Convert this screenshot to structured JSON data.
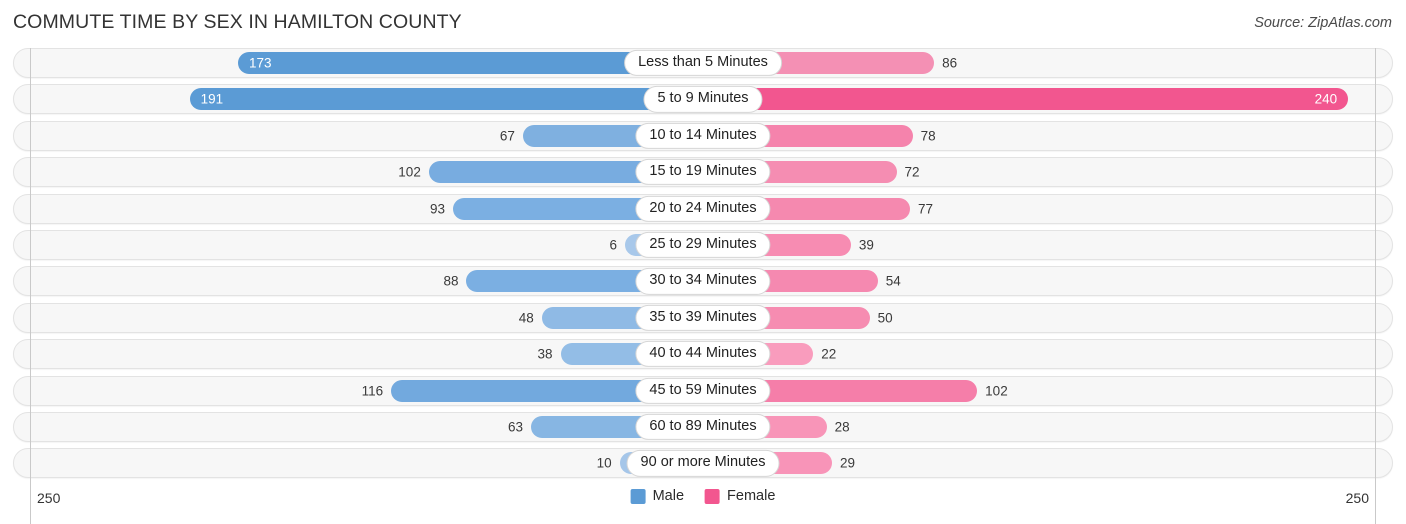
{
  "header": {
    "title": "COMMUTE TIME BY SEX IN HAMILTON COUNTY",
    "source": "Source: ZipAtlas.com"
  },
  "legend": {
    "male_label": "Male",
    "female_label": "Female",
    "male_color": "#5b9bd5",
    "female_color": "#f2568f"
  },
  "axis": {
    "left_max": "250",
    "right_max": "250"
  },
  "chart_data": {
    "type": "bar",
    "orientation": "horizontal-diverging",
    "title": "COMMUTE TIME BY SEX IN HAMILTON COUNTY",
    "xlabel": "",
    "ylabel": "",
    "axis_max": 250,
    "grid": false,
    "legend_position": "bottom-center",
    "categories": [
      "Less than 5 Minutes",
      "5 to 9 Minutes",
      "10 to 14 Minutes",
      "15 to 19 Minutes",
      "20 to 24 Minutes",
      "25 to 29 Minutes",
      "30 to 34 Minutes",
      "35 to 39 Minutes",
      "40 to 44 Minutes",
      "45 to 59 Minutes",
      "60 to 89 Minutes",
      "90 or more Minutes"
    ],
    "series": [
      {
        "name": "Male",
        "color": "#5b9bd5",
        "values": [
          173,
          191,
          67,
          102,
          93,
          6,
          88,
          48,
          38,
          116,
          63,
          10
        ]
      },
      {
        "name": "Female",
        "color": "#f2568f",
        "values": [
          86,
          240,
          78,
          72,
          77,
          39,
          54,
          50,
          22,
          102,
          28,
          29
        ]
      }
    ]
  },
  "rows": [
    {
      "category": "Less than 5 Minutes",
      "male": {
        "value": "173",
        "pct": 69.2,
        "color": "#5b9bd5",
        "inside": true
      },
      "female": {
        "value": "86",
        "pct": 34.4,
        "color": "#f490b4",
        "inside": false
      }
    },
    {
      "category": "5 to 9 Minutes",
      "male": {
        "value": "191",
        "pct": 76.4,
        "color": "#5b9bd5",
        "inside": true
      },
      "female": {
        "value": "240",
        "pct": 96.0,
        "color": "#f2568f",
        "inside": true
      }
    },
    {
      "category": "10 to 14 Minutes",
      "male": {
        "value": "67",
        "pct": 26.8,
        "color": "#7fb0e0",
        "inside": false
      },
      "female": {
        "value": "78",
        "pct": 31.2,
        "color": "#f583ac",
        "inside": false
      }
    },
    {
      "category": "15 to 19 Minutes",
      "male": {
        "value": "102",
        "pct": 40.8,
        "color": "#78ace0",
        "inside": false
      },
      "female": {
        "value": "72",
        "pct": 28.8,
        "color": "#f58db2",
        "inside": false
      }
    },
    {
      "category": "20 to 24 Minutes",
      "male": {
        "value": "93",
        "pct": 37.2,
        "color": "#7bafe2",
        "inside": false
      },
      "female": {
        "value": "77",
        "pct": 30.8,
        "color": "#f589af",
        "inside": false
      }
    },
    {
      "category": "25 to 29 Minutes",
      "male": {
        "value": "6",
        "pct": 11.6,
        "color": "#a8c8ea",
        "inside": false
      },
      "female": {
        "value": "39",
        "pct": 22.0,
        "color": "#f78cb2",
        "inside": false
      }
    },
    {
      "category": "30 to 34 Minutes",
      "male": {
        "value": "88",
        "pct": 35.2,
        "color": "#7bafe2",
        "inside": false
      },
      "female": {
        "value": "54",
        "pct": 26.0,
        "color": "#f589b0",
        "inside": false
      }
    },
    {
      "category": "35 to 39 Minutes",
      "male": {
        "value": "48",
        "pct": 24.0,
        "color": "#8fbae5",
        "inside": false
      },
      "female": {
        "value": "50",
        "pct": 24.8,
        "color": "#f68cb1",
        "inside": false
      }
    },
    {
      "category": "40 to 44 Minutes",
      "male": {
        "value": "38",
        "pct": 21.2,
        "color": "#93bde6",
        "inside": false
      },
      "female": {
        "value": "22",
        "pct": 16.4,
        "color": "#f99cbd",
        "inside": false
      }
    },
    {
      "category": "45 to 59 Minutes",
      "male": {
        "value": "116",
        "pct": 46.4,
        "color": "#72a9de",
        "inside": false
      },
      "female": {
        "value": "102",
        "pct": 40.8,
        "color": "#f57ea9",
        "inside": false
      }
    },
    {
      "category": "60 to 89 Minutes",
      "male": {
        "value": "63",
        "pct": 25.6,
        "color": "#87b6e3",
        "inside": false
      },
      "female": {
        "value": "28",
        "pct": 18.4,
        "color": "#f895b8",
        "inside": false
      }
    },
    {
      "category": "90 or more Minutes",
      "male": {
        "value": "10",
        "pct": 12.4,
        "color": "#a5c6e9",
        "inside": false
      },
      "female": {
        "value": "29",
        "pct": 19.2,
        "color": "#f894b8",
        "inside": false
      }
    }
  ]
}
